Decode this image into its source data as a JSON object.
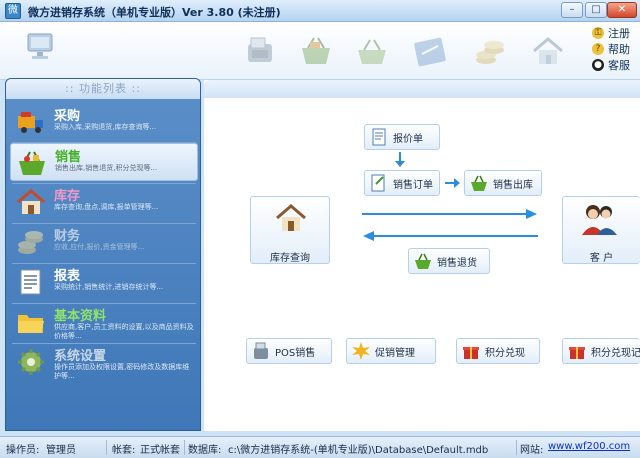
{
  "window": {
    "title": "微方进销存系统（单机专业版）Ver 3.80 (未注册)",
    "minimize": "–",
    "maximize": "□",
    "close": "✕"
  },
  "top_links": [
    {
      "label": "注册",
      "icon": "key-icon"
    },
    {
      "label": "帮助",
      "icon": "help-icon"
    },
    {
      "label": "客服",
      "icon": "qq-icon"
    }
  ],
  "sidebar": {
    "header": ":: 功能列表 ::",
    "items": [
      {
        "label": "采购",
        "desc": "采购入库,采购退货,库存查询等..."
      },
      {
        "label": "销售",
        "desc": "销售出库,销售退货,积分兑现等..."
      },
      {
        "label": "库存",
        "desc": "库存查询,盘点,调库,报单管理等..."
      },
      {
        "label": "财务",
        "desc": "应收,应付,报价,资金管理等..."
      },
      {
        "label": "报表",
        "desc": "采购统计,销售统计,进销存统计等..."
      },
      {
        "label": "基本资料",
        "desc": "供应商,客户,员工资料的设置,以及商品资料及价格等..."
      },
      {
        "label": "系统设置",
        "desc": "操作员添加及权限设置,密码修改及数据库维护等..."
      }
    ]
  },
  "flow": {
    "quote": "报价单",
    "sales_order": "销售订单",
    "sales_out": "销售出库",
    "sales_return": "销售退货",
    "inventory_query": "库存查询",
    "customer": "客 户",
    "pos": "POS销售",
    "promotion": "促销管理",
    "points": "积分兑现",
    "points_record": "积分兑现记录"
  },
  "status": {
    "operator_label": "操作员:",
    "operator_value": "管理员",
    "account_label": "帐套:",
    "account_value": "正式帐套",
    "db_label": "数据库:",
    "db_value": "c:\\微方进销存系统-(单机专业版)\\Database\\Default.mdb",
    "site_label": "网站:",
    "site_value": "www.wf200.com"
  },
  "colors": {
    "accent": "#3f77b8",
    "active_label": "#46b22a",
    "link": "#0a32c8"
  }
}
